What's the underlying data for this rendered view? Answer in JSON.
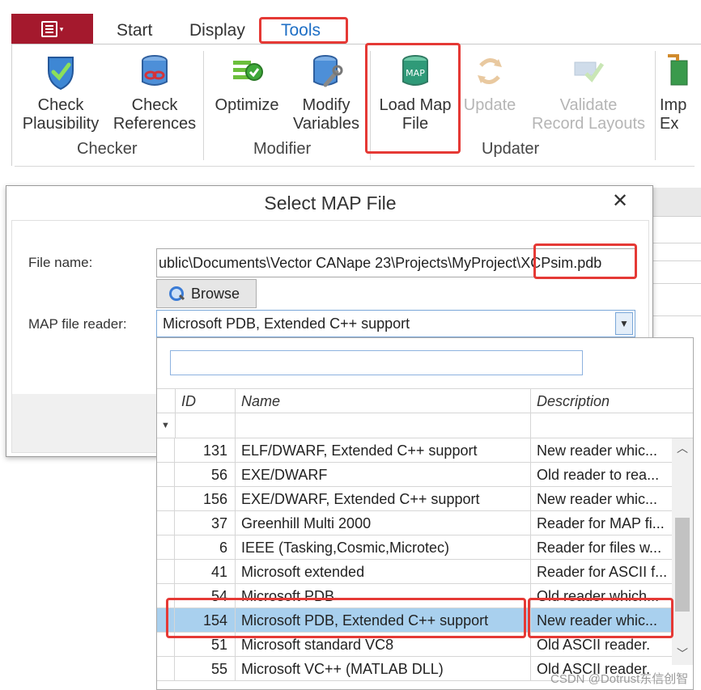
{
  "ribbon": {
    "tabs": [
      {
        "label": "Start"
      },
      {
        "label": "Display"
      },
      {
        "label": "Tools"
      }
    ],
    "groups": {
      "checker": {
        "label": "Checker",
        "buttons": [
          {
            "line1": "Check",
            "line2": "Plausibility",
            "icon": "shield-check-icon"
          },
          {
            "line1": "Check",
            "line2": "References",
            "icon": "database-link-icon"
          }
        ]
      },
      "modifier": {
        "label": "Modifier",
        "buttons": [
          {
            "line1": "Optimize",
            "line2": "",
            "icon": "list-check-icon"
          },
          {
            "line1": "Modify",
            "line2": "Variables",
            "icon": "database-wrench-icon"
          }
        ]
      },
      "updater": {
        "label": "Updater",
        "buttons": [
          {
            "line1": "Load Map",
            "line2": "File",
            "icon": "map-database-icon"
          },
          {
            "line1": "Update",
            "line2": "",
            "icon": "refresh-icon",
            "disabled": true
          },
          {
            "line1": "Validate",
            "line2": "Record Layouts",
            "icon": "validate-records-icon",
            "disabled": true
          }
        ]
      },
      "import": {
        "line1": "Imp",
        "line2": "Ex",
        "icon": "import-export-icon"
      }
    }
  },
  "dialog": {
    "title": "Select MAP File",
    "close_glyph": "✕",
    "file_name_label": "File name:",
    "file_name_value": "ublic\\Documents\\Vector CANape 23\\Projects\\MyProject\\XCPsim.pdb",
    "browse_label": "Browse",
    "reader_label": "MAP file reader:",
    "reader_value": "Microsoft PDB, Extended C++ support"
  },
  "popup": {
    "search_value": "",
    "columns": {
      "id": "ID",
      "name": "Name",
      "description": "Description"
    },
    "rows": [
      {
        "id": "131",
        "name": "ELF/DWARF, Extended C++ support",
        "desc": "New reader whic..."
      },
      {
        "id": "56",
        "name": "EXE/DWARF",
        "desc": "Old reader to rea..."
      },
      {
        "id": "156",
        "name": "EXE/DWARF, Extended C++ support",
        "desc": "New reader whic..."
      },
      {
        "id": "37",
        "name": "Greenhill Multi 2000",
        "desc": "Reader for MAP fi..."
      },
      {
        "id": "6",
        "name": "IEEE (Tasking,Cosmic,Microtec)",
        "desc": "Reader for files w..."
      },
      {
        "id": "41",
        "name": "Microsoft extended",
        "desc": "Reader for ASCII f..."
      },
      {
        "id": "54",
        "name": "Microsoft PDB",
        "desc": "Old reader which..."
      },
      {
        "id": "154",
        "name": "Microsoft PDB, Extended C++ support",
        "desc": "New reader whic...",
        "selected": true
      },
      {
        "id": "51",
        "name": "Microsoft standard VC8",
        "desc": "Old ASCII reader."
      },
      {
        "id": "55",
        "name": "Microsoft VC++ (MATLAB DLL)",
        "desc": "Old ASCII reader."
      }
    ]
  },
  "colors": {
    "accent": "#1f6fc5",
    "app_button": "#a4192d",
    "highlight": "#e53935",
    "selection": "#a9d0ee"
  },
  "watermark": "CSDN @Dotrust东信创智"
}
